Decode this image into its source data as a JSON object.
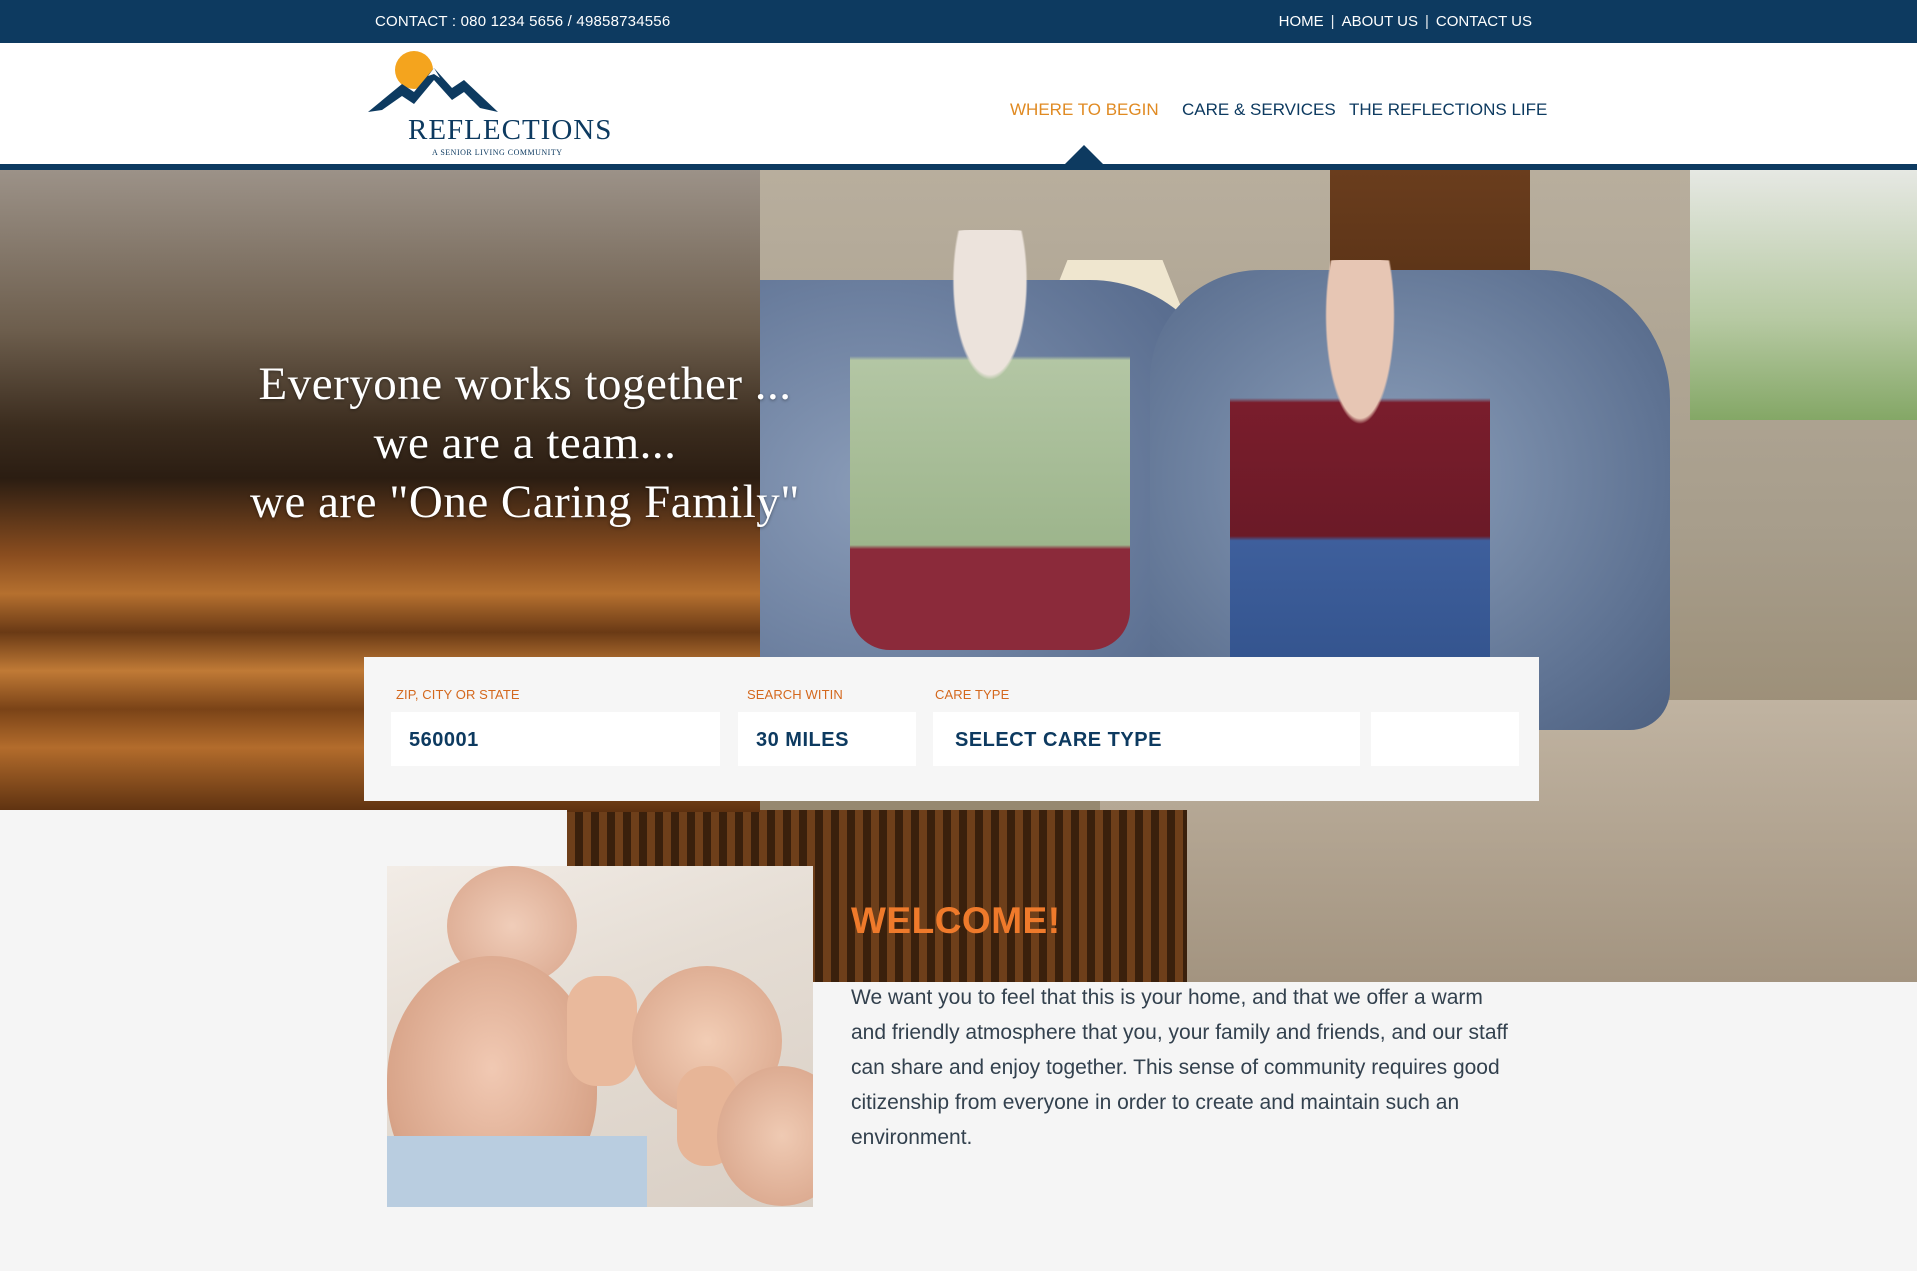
{
  "topbar": {
    "contact": "CONTACT : 080 1234 5656 / 49858734556",
    "links": [
      {
        "label": "HOME"
      },
      {
        "label": "ABOUT US"
      },
      {
        "label": "CONTACT US"
      }
    ],
    "separator": "|"
  },
  "logo": {
    "name": "REFLECTIONS",
    "tagline": "A SENIOR LIVING COMMUNITY",
    "icon": "mountain-sun-icon"
  },
  "nav": {
    "items": [
      {
        "label": "WHERE TO BEGIN",
        "active": true
      },
      {
        "label": "CARE & SERVICES",
        "active": false
      },
      {
        "label": "THE REFLECTIONS LIFE",
        "active": false
      }
    ]
  },
  "hero": {
    "lines": [
      "Everyone works together ...",
      "we are a team...",
      "we are \"One Caring Family\""
    ]
  },
  "search": {
    "location_label": "ZIP, CITY OR STATE",
    "location_value": "560001",
    "distance_label": "SEARCH WITIN",
    "distance_value": "30 MILES",
    "care_label": "CARE TYPE",
    "care_value": "SELECT CARE TYPE"
  },
  "welcome": {
    "title": "WELCOME!",
    "text": "We want you to feel that this is your home, and that we offer a warm and friendly atmosphere that you, your family and friends, and our staff can share and enjoy together. This sense of community requires good citizenship from everyone in order to create and maintain such an environment."
  },
  "colors": {
    "primary": "#0d3a60",
    "accent": "#ef7a2b",
    "active_nav": "#e08a22"
  }
}
